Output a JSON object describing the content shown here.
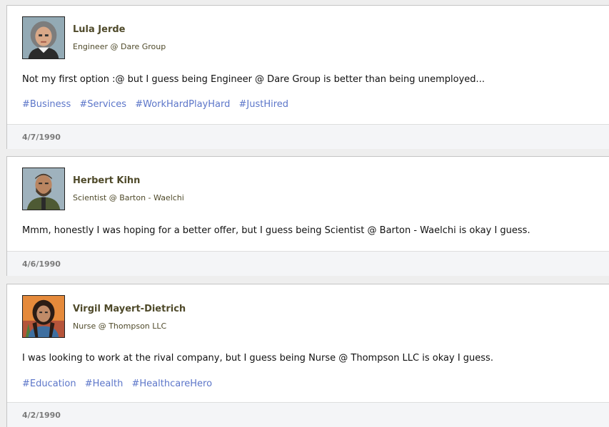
{
  "posts": [
    {
      "author": "Lula Jerde",
      "role": "Engineer @ Dare Group",
      "text": "Not my first option :@ but I guess being Engineer @ Dare Group is better than being unemployed...",
      "tags": [
        "#Business",
        "#Services",
        "#WorkHardPlayHard",
        "#JustHired"
      ],
      "date": "4/7/1990",
      "avatar_icon": "avatar-older-woman-icon"
    },
    {
      "author": "Herbert Kihn",
      "role": "Scientist @ Barton - Waelchi",
      "text": "Mmm, honestly I was hoping for a better offer, but I guess being Scientist @ Barton - Waelchi is okay I guess.",
      "tags": [],
      "date": "4/6/1990",
      "avatar_icon": "avatar-bearded-man-icon"
    },
    {
      "author": "Virgil Mayert-Dietrich",
      "role": "Nurse @ Thompson LLC",
      "text": "I was looking to work at the rival company, but I guess being Nurse @ Thompson LLC is okay I guess.",
      "tags": [
        "#Education",
        "#Health",
        "#HealthcareHero"
      ],
      "date": "4/2/1990",
      "avatar_icon": "avatar-long-hair-man-icon"
    }
  ],
  "colors": {
    "author": "#4f4a2a",
    "tag": "#5c76c9",
    "footer_bg": "#f4f5f7",
    "date": "#7a7a7a"
  }
}
